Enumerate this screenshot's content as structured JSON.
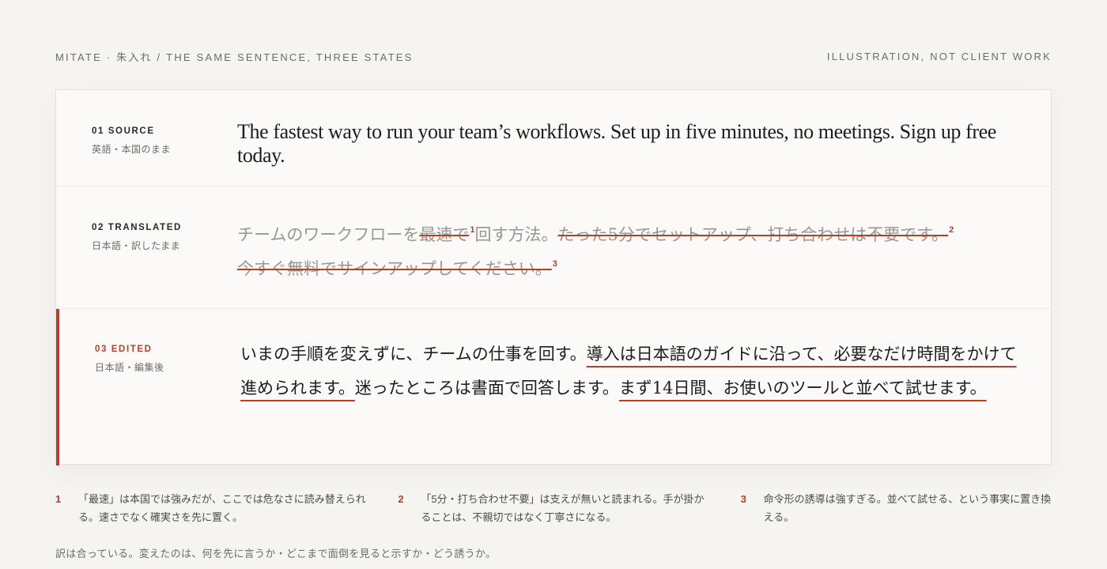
{
  "header": {
    "left": "MITATE · 朱入れ / THE SAME SENTENCE, THREE STATES",
    "right": "ILLUSTRATION, NOT CLIENT WORK"
  },
  "rows": {
    "source": {
      "num": "01 SOURCE",
      "sub": "英語・本国のまま",
      "text": "The fastest way to run your team’s workflows. Set up in five minutes, no meetings. Sign up free today."
    },
    "translated": {
      "num": "02 TRANSLATED",
      "sub": "日本語・訳したまま",
      "seg1": "チームのワークフローを",
      "seg2": "最速で",
      "fn1": "1",
      "seg3": "回す方法。",
      "seg4": "たった5分でセットアップ、打ち合わせは不要です。",
      "fn2": "2",
      "seg5": "今すぐ無料でサインアップしてください。",
      "fn3": "3"
    },
    "edited": {
      "num": "03 EDITED",
      "sub": "日本語・編集後",
      "seg1": "いまの手順を変えずに、チームの仕事を回す。",
      "seg2": "導入は日本語のガイドに沿って、必要なだけ時間をかけて進められます。",
      "seg3": "迷ったところは書面で回答します。",
      "seg4": "まず14日間、お使いのツールと並べて試せます。"
    }
  },
  "notes": [
    {
      "num": "1",
      "text": "「最速」は本国では強みだが、ここでは危なさに読み替えられる。速さでなく確実さを先に置く。"
    },
    {
      "num": "2",
      "text": "「5分・打ち合わせ不要」は支えが無いと読まれる。手が掛かることは、不親切ではなく丁寧さになる。"
    },
    {
      "num": "3",
      "text": "命令形の誘導は強すぎる。並べて試せる、という事実に置き換える。"
    }
  ],
  "footer": "訳は合っている。変えたのは、何を先に言うか・どこまで面倒を見ると示すか・どう誘うか。",
  "colors": {
    "accent": "#b73e2d",
    "background": "#f5f4f1",
    "card": "#fbfaf8"
  }
}
